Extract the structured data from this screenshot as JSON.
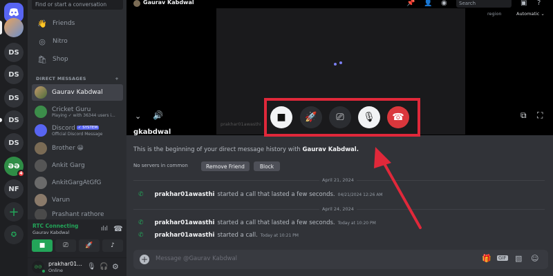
{
  "rail": {
    "servers": [
      "DS",
      "DS",
      "DS",
      "DS",
      "DS",
      "NF"
    ],
    "gfg_badge": "4"
  },
  "sidebar": {
    "search_placeholder": "Find or start a conversation",
    "nav": [
      "Friends",
      "Nitro",
      "Shop"
    ],
    "dm_heading": "DIRECT MESSAGES",
    "dm_add": "+",
    "dms": [
      {
        "name": "Gaurav Kabdwal",
        "sub": ""
      },
      {
        "name": "Cricket Guru",
        "sub": "Playing ✓ with 36344 users i..."
      },
      {
        "name": "Discord",
        "sub": "Official Discord Message",
        "tag": "✓ SYSTEM"
      },
      {
        "name": "Brother 😀",
        "sub": ""
      },
      {
        "name": "Ankit Garg",
        "sub": ""
      },
      {
        "name": "AnkitGargAtGfG",
        "sub": ""
      },
      {
        "name": "Varun",
        "sub": ""
      },
      {
        "name": "Prashant rathore",
        "sub": ""
      }
    ]
  },
  "rtc": {
    "status": "RTC Connecting",
    "channel": "Gaurav Kabdwal"
  },
  "user": {
    "name": "prakhar01...",
    "status": "Online"
  },
  "call": {
    "title": "Gaurav Kabdwal",
    "search_placeholder": "Search",
    "region_label": "region",
    "region_value": "Automatic",
    "watermark": "prakhar01awasthi"
  },
  "chat": {
    "partial_name": "gkabdwal",
    "intro_prefix": "This is the beginning of your direct message history with ",
    "intro_name": "Gaurav Kabdwal.",
    "no_servers": "No servers in common",
    "remove_friend": "Remove Friend",
    "block": "Block",
    "date1": "April 21, 2024",
    "date2": "April 24, 2024",
    "messages": [
      {
        "who": "prakhar01awasthi",
        "text": "started a call that lasted a few seconds.",
        "ts": "04/21/2024 12:26 AM"
      },
      {
        "who": "prakhar01awasthi",
        "text": "started a call that lasted a few seconds.",
        "ts": "Today at 10:20 PM"
      },
      {
        "who": "prakhar01awasthi",
        "text": "started a call.",
        "ts": "Today at 10:21 PM"
      }
    ],
    "composer_placeholder": "Message @Gaurav Kabdwal"
  },
  "colors": {
    "annotation": "#e0283a",
    "online": "#23a559",
    "hangup": "#da373c",
    "blurple": "#5865f2"
  }
}
